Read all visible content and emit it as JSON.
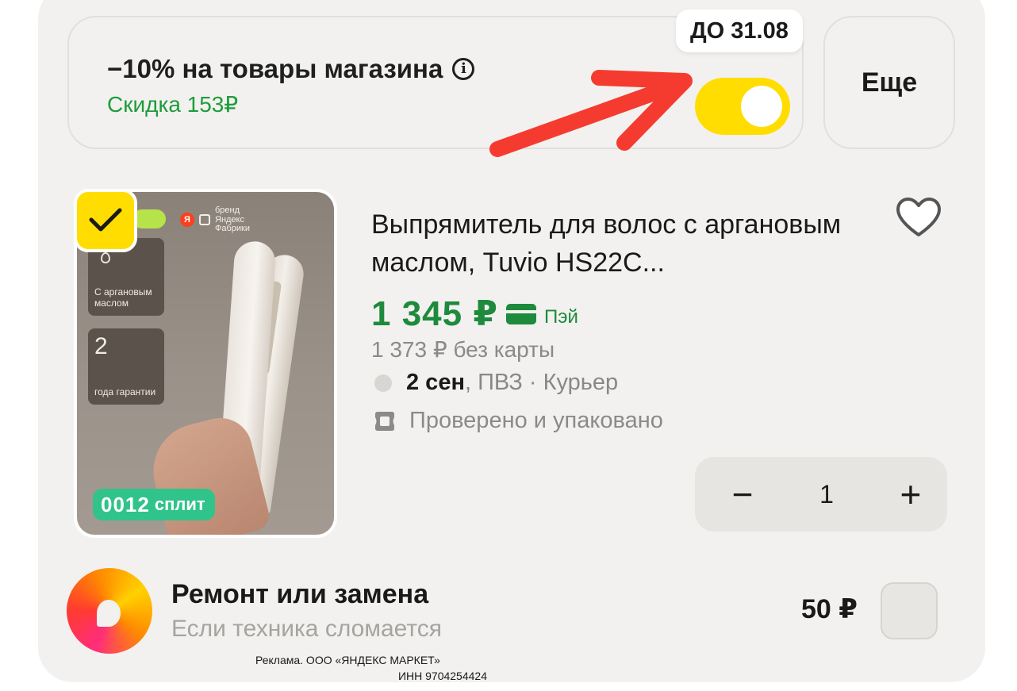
{
  "promo": {
    "title": "−10% на товары магазина",
    "info_icon": "info-icon",
    "subtitle": "Скидка 153₽",
    "deadline": "ДО 31.08",
    "toggle_on": true,
    "toggle_color": "#ffdd00",
    "arrow_color": "#f53b30"
  },
  "more_button": {
    "label": "Еще"
  },
  "product": {
    "selected": true,
    "image": {
      "brand_text": "бренд Яндекс Фабрики",
      "brand_logo_letter": "Я",
      "feature1_text": "С аргановым маслом",
      "feature2_number": "2",
      "feature2_text": "года гарантии",
      "split_number": "0012",
      "split_label": "сплит"
    },
    "title": "Выпрямитель для волос с аргановым маслом, Tuvio HS22C...",
    "price": "1 345 ₽",
    "pay_label": "Пэй",
    "price_color": "#1e8a3c",
    "old_price": "1 373 ₽ без карты",
    "delivery_date": "2 сен",
    "delivery_options": ", ПВЗ · Курьер",
    "checked_label": "Проверено и упаковано",
    "quantity": "1",
    "minus": "−",
    "plus": "+"
  },
  "repair": {
    "title": "Ремонт или замена",
    "subtitle": "Если техника сломается",
    "price": "50 ₽"
  },
  "ad": {
    "line1": "Реклама. ООО «ЯНДЕКС МАРКЕТ»",
    "line2": "ИНН 9704254424"
  }
}
